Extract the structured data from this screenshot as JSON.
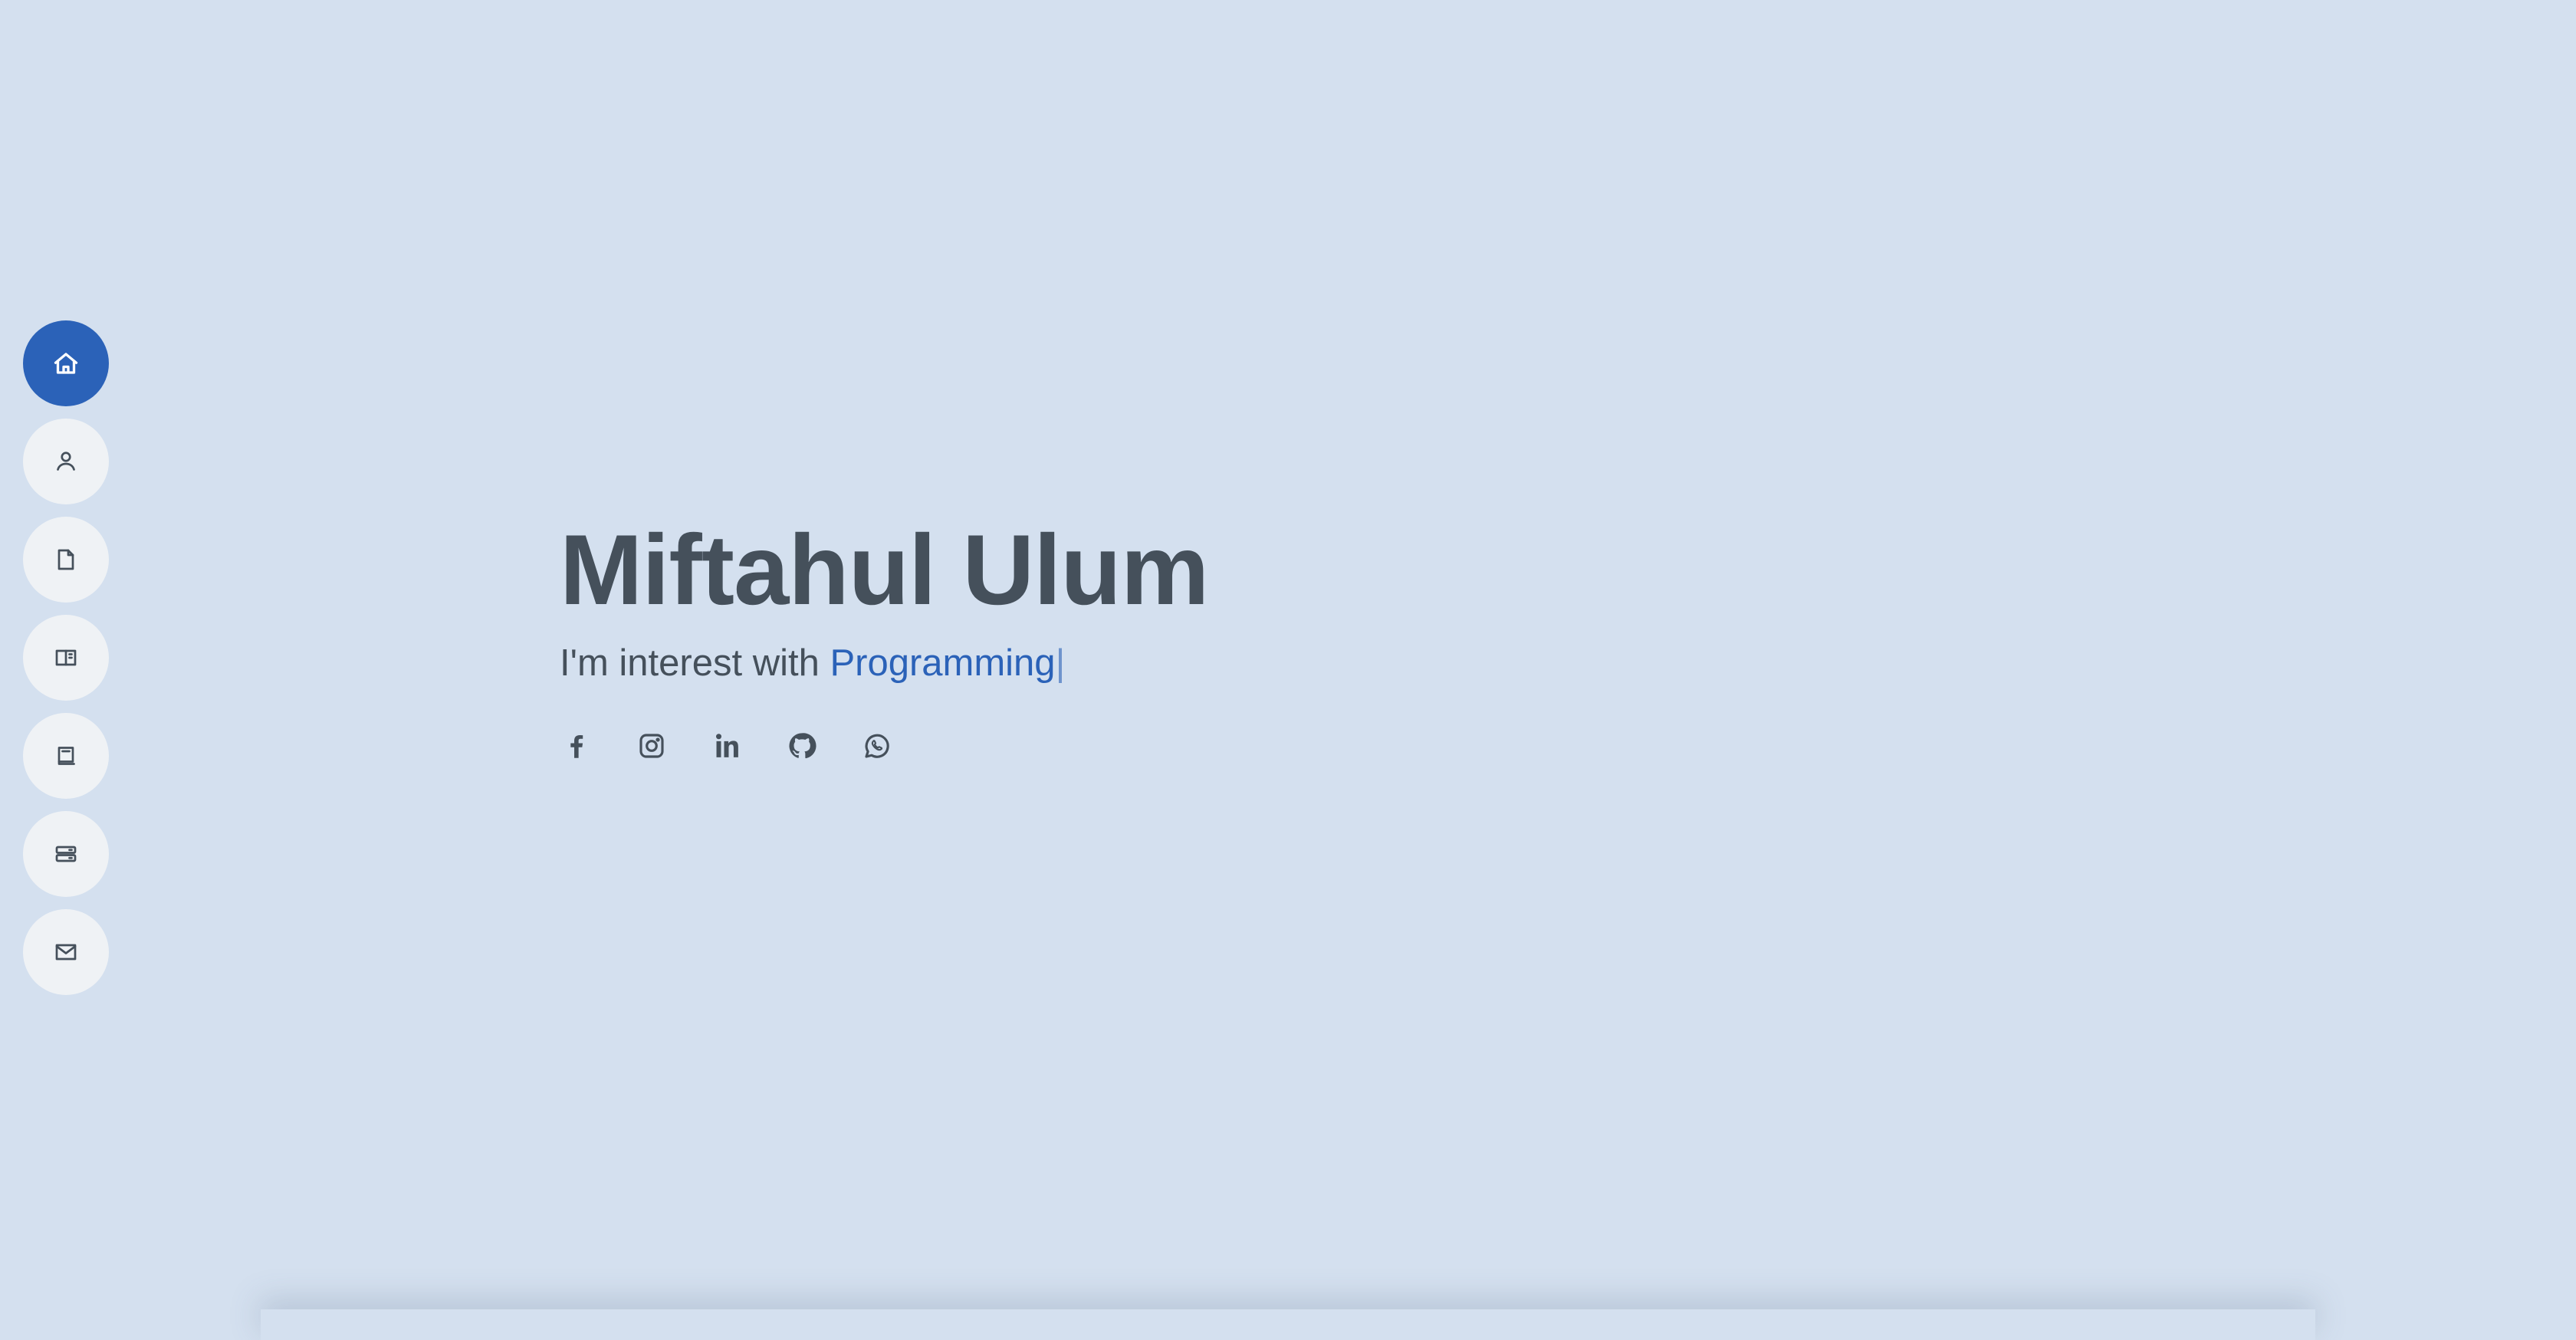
{
  "nav": {
    "items": [
      {
        "name": "home",
        "icon": "home-icon",
        "active": true
      },
      {
        "name": "about",
        "icon": "person-icon",
        "active": false
      },
      {
        "name": "resume",
        "icon": "file-icon",
        "active": false
      },
      {
        "name": "portfolio",
        "icon": "book-open-icon",
        "active": false
      },
      {
        "name": "journal",
        "icon": "book-icon",
        "active": false
      },
      {
        "name": "services",
        "icon": "server-icon",
        "active": false
      },
      {
        "name": "contact",
        "icon": "envelope-icon",
        "active": false
      }
    ]
  },
  "hero": {
    "name": "Miftahul Ulum",
    "subtitle_prefix": "I'm interest with ",
    "typed_word": "Programming",
    "cursor": "|"
  },
  "social": [
    "facebook",
    "instagram",
    "linkedin",
    "github",
    "whatsapp"
  ],
  "colors": {
    "background": "#d4e0ef",
    "accent": "#2b62b8",
    "text": "#45505b",
    "nav_bg": "#eff2f5"
  }
}
